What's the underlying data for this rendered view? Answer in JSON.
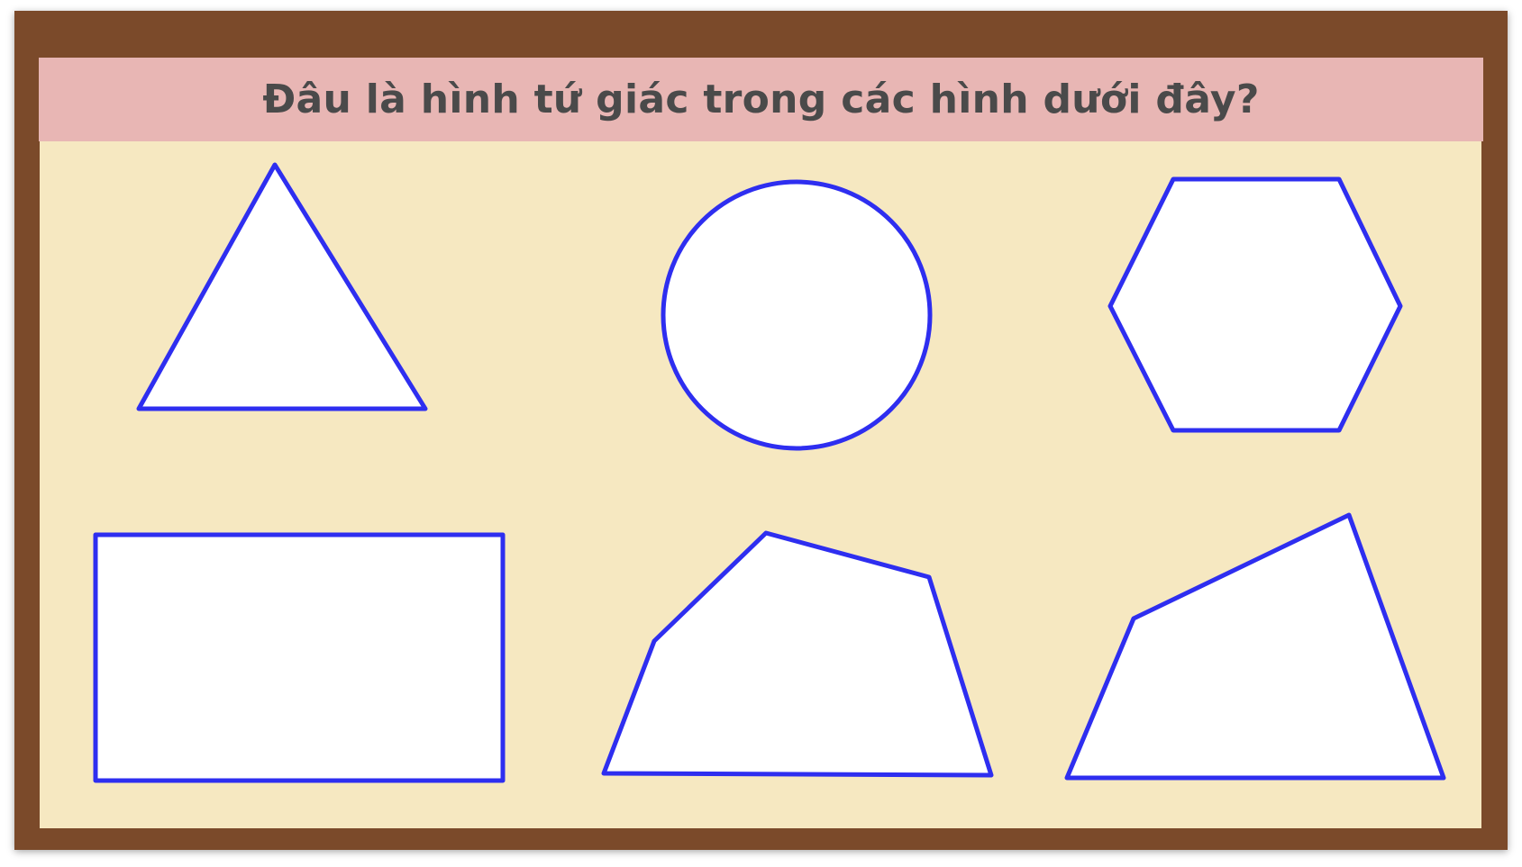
{
  "question": {
    "text": "Đâu là hình tứ giác trong các hình dưới đây?"
  },
  "shapes": [
    {
      "name": "triangle",
      "sides": 3
    },
    {
      "name": "circle",
      "sides": 0
    },
    {
      "name": "hexagon",
      "sides": 6
    },
    {
      "name": "rectangle",
      "sides": 4
    },
    {
      "name": "pentagon",
      "sides": 5
    },
    {
      "name": "quadrilateral",
      "sides": 4
    }
  ],
  "colors": {
    "frame": "#7b4a2a",
    "board": "#f6e8c1",
    "title_bar": "#e8b6b4",
    "title_text": "#4a4a4a",
    "shape_stroke": "#2e2ef0",
    "shape_fill": "#ffffff"
  }
}
